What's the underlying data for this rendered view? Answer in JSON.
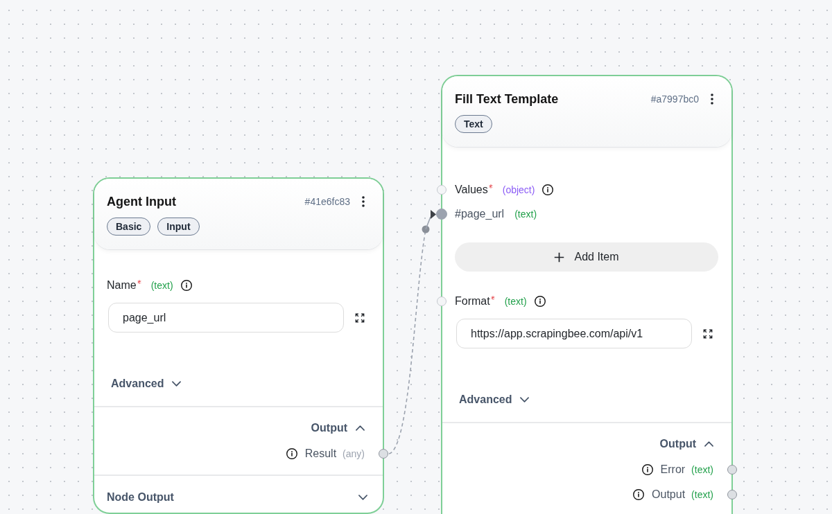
{
  "nodes": [
    {
      "title": "Agent Input",
      "node_id": "#41e6fc83",
      "badges": [
        "Basic",
        "Input"
      ],
      "inputs": [
        {
          "kind": "field",
          "label": "Name",
          "required": true,
          "type": {
            "text": "(text)",
            "color": "#22a04b"
          },
          "info": true,
          "value": "page_url"
        }
      ],
      "advanced": {
        "label": "Advanced",
        "expanded": false
      },
      "output_section": {
        "label": "Output",
        "expanded": true,
        "outputs": [
          {
            "label": "Result",
            "type": {
              "text": "(any)",
              "color": "#9ca3af"
            }
          }
        ]
      },
      "node_output": {
        "label": "Node Output",
        "expanded": false
      }
    },
    {
      "title": "Fill Text Template",
      "node_id": "#a7997bc0",
      "badges": [
        "Text"
      ],
      "inputs": [
        {
          "kind": "list",
          "label": "Values",
          "required": true,
          "type": {
            "text": "(object)",
            "color": "#8b5cf6"
          },
          "info": true,
          "handle": {
            "connected": false
          },
          "items": [
            {
              "label": "#page_url",
              "type": {
                "text": "(text)",
                "color": "#22a04b"
              },
              "handle": {
                "connected": true
              }
            }
          ],
          "add_button": "Add Item"
        },
        {
          "kind": "field",
          "label": "Format",
          "required": true,
          "type": {
            "text": "(text)",
            "color": "#22a04b"
          },
          "info": true,
          "handle": {
            "connected": false
          },
          "value": "https://app.scrapingbee.com/api/v1"
        }
      ],
      "advanced": {
        "label": "Advanced",
        "expanded": false
      },
      "output_section": {
        "label": "Output",
        "expanded": true,
        "outputs": [
          {
            "label": "Error",
            "type": {
              "text": "(text)",
              "color": "#22a04b"
            }
          },
          {
            "label": "Output",
            "type": {
              "text": "(text)",
              "color": "#22a04b"
            }
          }
        ]
      }
    }
  ]
}
